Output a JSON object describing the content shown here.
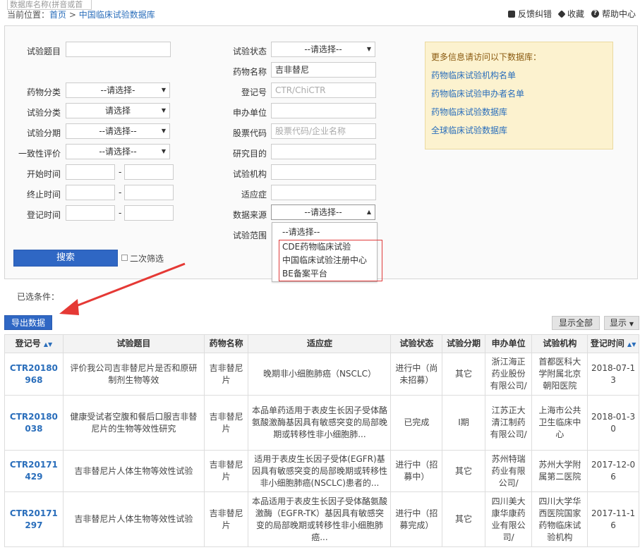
{
  "top": {
    "db_search_placeholder": "数据库名称(拼音或首",
    "breadcrumb_prefix": "当前位置：",
    "breadcrumb_home": "首页",
    "breadcrumb_sep": ">",
    "breadcrumb_current": "中国临床试验数据库",
    "links": {
      "feedback": "反馈纠错",
      "favorite": "收藏",
      "help": "帮助中心"
    }
  },
  "form": {
    "labels": {
      "trial_title": "试验题目",
      "drug_category": "药物分类",
      "trial_category": "试验分类",
      "trial_phase": "试验分期",
      "consistency": "一致性评价",
      "start_time": "开始时间",
      "end_time": "终止时间",
      "reg_time": "登记时间",
      "trial_status": "试验状态",
      "drug_name": "药物名称",
      "reg_no": "登记号",
      "sponsor": "申办单位",
      "stock_code": "股票代码",
      "purpose": "研究目的",
      "institution": "试验机构",
      "indication": "适应症",
      "data_source": "数据来源",
      "trial_scope": "试验范围"
    },
    "values": {
      "drug_name": "吉非替尼",
      "drug_category": "--请选择-",
      "trial_category": "请选择",
      "trial_phase": "--请选择--",
      "consistency": "--请选择--",
      "trial_status": "--请选择--",
      "data_source": "--请选择--",
      "range_dash": "-"
    },
    "placeholders": {
      "reg_no": "CTR/ChiCTR",
      "stock_code": "股票代码/企业名称"
    },
    "data_source_options": [
      "--请选择--",
      "CDE药物临床试验",
      "中国临床试验注册中心",
      "BE备案平台"
    ],
    "search_button": "搜索",
    "secondary_filter": "二次筛选"
  },
  "infobox": {
    "title": "更多信息请访问以下数据库：",
    "links": [
      "药物临床试验机构名单",
      "药物临床试验申办者名单",
      "药物临床试验数据库",
      "全球临床试验数据库"
    ]
  },
  "results": {
    "selected_conditions": "已选条件：",
    "export_button": "导出数据",
    "show_all_button": "显示全部",
    "show_button": "显示",
    "columns": [
      "登记号",
      "试验题目",
      "药物名称",
      "适应症",
      "试验状态",
      "试验分期",
      "申办单位",
      "试验机构",
      "登记时间"
    ],
    "rows": [
      {
        "reg_no": "CTR20180968",
        "title": "评价我公司吉非替尼片是否和原研制剂生物等效",
        "drug": "吉非替尼片",
        "indication": "晚期非小细胞肺癌（NSCLC）",
        "status": "进行中（尚未招募）",
        "phase": "其它",
        "sponsor": "浙江海正药业股份有限公司/",
        "institution": "首都医科大学附属北京朝阳医院",
        "date": "2018-07-13"
      },
      {
        "reg_no": "CTR20180038",
        "title": "健康受试者空腹和餐后口服吉非替尼片的生物等效性研究",
        "drug": "吉非替尼片",
        "indication": "本品单药适用于表皮生长因子受体酪氨酸激酶基因具有敏感突变的局部晚期或转移性非小细胞肺...",
        "status": "已完成",
        "phase": "I期",
        "sponsor": "江苏正大清江制药有限公司/",
        "institution": "上海市公共卫生临床中心",
        "date": "2018-01-30"
      },
      {
        "reg_no": "CTR20171429",
        "title": "吉非替尼片人体生物等效性试验",
        "drug": "吉非替尼片",
        "indication": "适用于表皮生长因子受体(EGFR)基因具有敏感突变的局部晚期或转移性非小细胞肺癌(NSCLC)患者的...",
        "status": "进行中（招募中）",
        "phase": "其它",
        "sponsor": "苏州特瑞药业有限公司/",
        "institution": "苏州大学附属第二医院",
        "date": "2017-12-06"
      },
      {
        "reg_no": "CTR20171297",
        "title": "吉非替尼片人体生物等效性试验",
        "drug": "吉非替尼片",
        "indication": "本品适用于表皮生长因子受体酪氨酸激酶（EGFR-TK）基因具有敏感突变的局部晚期或转移性非小细胞肺癌...",
        "status": "进行中（招募完成）",
        "phase": "其它",
        "sponsor": "四川美大康华康药业有限公司/",
        "institution": "四川大学华西医院国家药物临床试验机构",
        "date": "2017-11-16"
      }
    ]
  }
}
